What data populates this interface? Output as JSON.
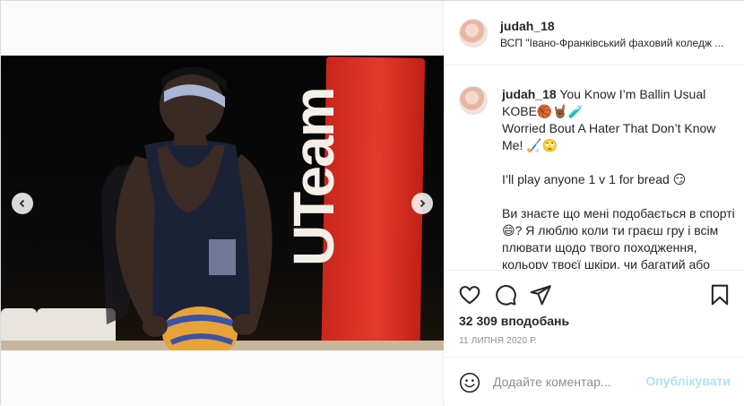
{
  "post": {
    "author": {
      "username": "judah_18",
      "location": "ВСП \"Івано-Франківський фаховий коледж ...",
      "avatar_icon": "avatar-photo"
    },
    "caption": {
      "username": "judah_18",
      "text": " You Know I’m Ballin Usual KOBE🏀🤘🏾🧪\nWorried Bout A Hater That Don’t Know Me! 🏑🙄\n\nI’ll play anyone 1 v 1 for bread 😏\n\nВи знаєте що мені подобається в спорті😄? Я люблю коли ти граєш гру і всім плювати щодо твого походження, кольору твоєї шкіри, чи багатий або бідний - “чіті ок” 👨🏾 Так"
    },
    "actions": {
      "like_icon": "heart-icon",
      "comment_icon": "comment-icon",
      "share_icon": "paper-plane-icon",
      "save_icon": "bookmark-icon"
    },
    "likes_text": "32 309 вподобань",
    "date_text": "11 ЛИПНЯ 2020 Р.",
    "comment": {
      "placeholder": "Додайте коментар...",
      "post_label": "Опублікувати",
      "post_color": "#b2dffc"
    },
    "media": {
      "banner_text": "UTeam",
      "prev_icon": "chevron-left-icon",
      "next_icon": "chevron-right-icon"
    }
  }
}
